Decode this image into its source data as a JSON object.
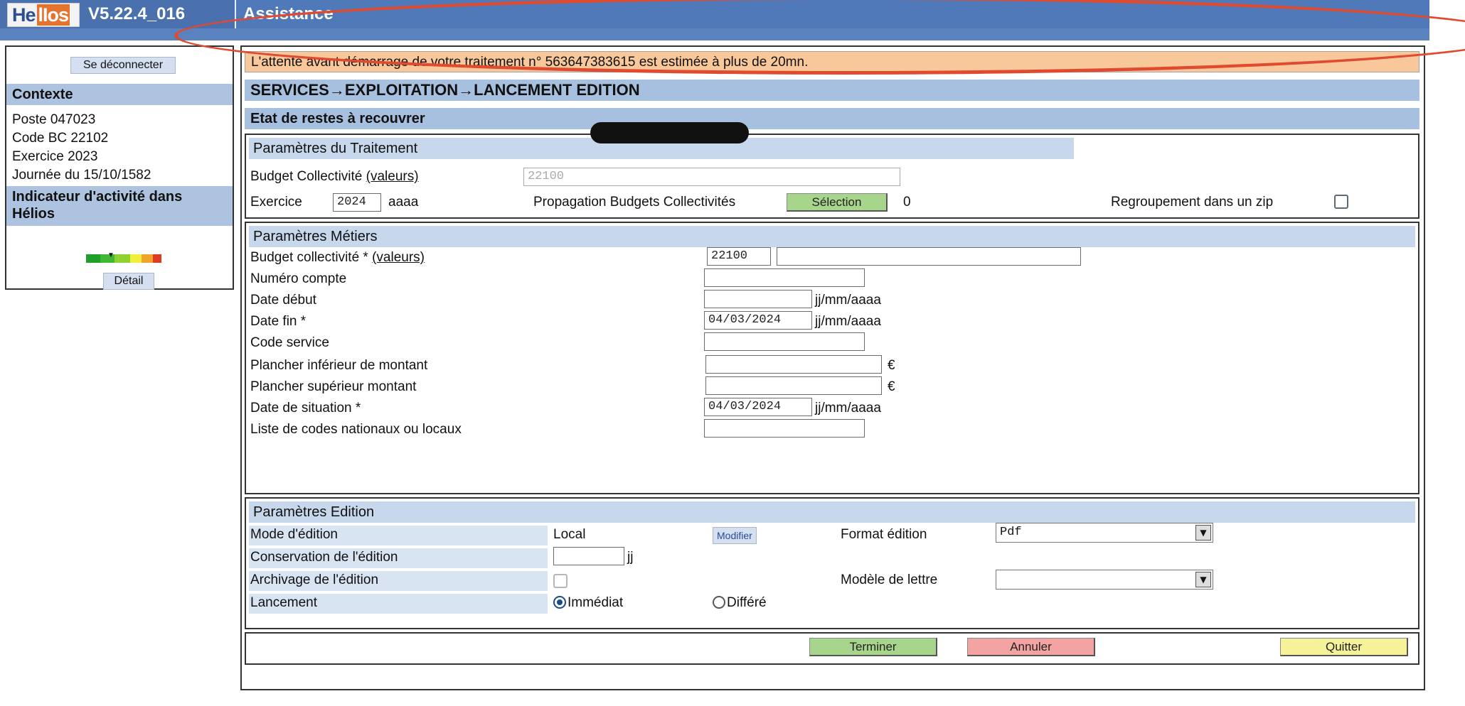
{
  "app": {
    "logo_text": "HelIos",
    "version": "V5.22.4_016",
    "title": "Assistance"
  },
  "sidebar": {
    "logout_label": "Se déconnecter",
    "context_title": "Contexte",
    "context_lines": [
      "Poste 047023",
      "Code BC 22102",
      "Exercice 2023",
      "Journée du 15/10/1582"
    ],
    "indicator_title_line1": "Indicateur d'activité dans",
    "indicator_title_line2": "Hélios",
    "indicator_colors": [
      "#1f9e2c",
      "#41b832",
      "#8fd12f",
      "#f2ee3a",
      "#f0a52a",
      "#e03a23"
    ],
    "detail_label": "Détail"
  },
  "alert": {
    "text": "L'attente avant démarrage de votre traitement n° 563647383615 est estimée à plus de 20mn."
  },
  "breadcrumb": "SERVICES→EXPLOITATION→LANCEMENT EDITION",
  "subtitle": "Etat de restes à recouvrer",
  "traitement": {
    "title": "Paramètres du Traitement",
    "budget_label": "Budget Collectivité",
    "valeurs_link": "(valeurs)",
    "budget_code": "22100",
    "exercice_label": "Exercice",
    "exercice_value": "2024",
    "exercice_format": "aaaa",
    "propagation_label": "Propagation Budgets Collectivités",
    "selection_label": "Sélection",
    "selection_count": "0",
    "zip_label": "Regroupement dans un zip",
    "zip_checked": false
  },
  "metiers": {
    "title": "Paramètres Métiers",
    "budget_label": "Budget collectivité *",
    "valeurs_link": "(valeurs)",
    "budget_code": "22100",
    "budget_name": "",
    "numero_compte_label": "Numéro compte",
    "numero_compte_value": "",
    "date_debut_label": "Date début",
    "date_debut_value": "",
    "date_format": "jj/mm/aaaa",
    "date_fin_label": "Date fin *",
    "date_fin_value": "04/03/2024",
    "code_service_label": "Code service",
    "code_service_value": "",
    "plancher_inf_label": "Plancher inférieur de montant",
    "plancher_inf_value": "",
    "plancher_sup_label": "Plancher supérieur montant",
    "plancher_sup_value": "",
    "currency": "€",
    "date_situation_label": "Date de situation *",
    "date_situation_value": "04/03/2024",
    "liste_codes_label": "Liste de codes nationaux ou locaux",
    "liste_codes_value": ""
  },
  "edition": {
    "title": "Paramètres Edition",
    "mode_label": "Mode d'édition",
    "mode_value": "Local",
    "modifier_label": "Modifier",
    "format_label": "Format édition",
    "format_value": "Pdf",
    "conservation_label": "Conservation de l'édition",
    "conservation_value": "",
    "conservation_unit": "jj",
    "archivage_label": "Archivage de l'édition",
    "archivage_checked": false,
    "modele_label": "Modèle de lettre",
    "modele_value": "",
    "lancement_label": "Lancement",
    "immediat_label": "Immédiat",
    "differe_label": "Différé",
    "lancement_selected": "Immédiat"
  },
  "actions": {
    "terminer_label": "Terminer",
    "terminer_color": "#a8d58c",
    "annuler_label": "Annuler",
    "annuler_color": "#f4a3a3",
    "quitter_label": "Quitter",
    "quitter_color": "#f6f29a"
  },
  "annotation_color": "#e04a2e"
}
